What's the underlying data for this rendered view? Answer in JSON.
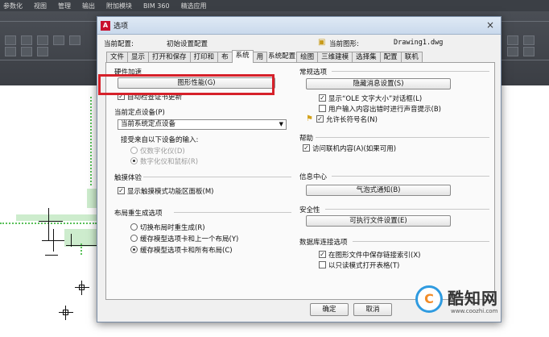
{
  "cad": {
    "menu": [
      "参数化",
      "视图",
      "管理",
      "输出",
      "附加模块",
      "BIM 360",
      "精选应用"
    ]
  },
  "dialog": {
    "title": "选项",
    "close": "×",
    "current_profile_label": "当前配置:",
    "current_profile_value": "初始设置配置",
    "current_drawing_label": "当前图形:",
    "current_drawing_value": "Drawing1.dwg",
    "tabs": [
      "文件",
      "显示",
      "打开和保存",
      "打印和",
      "布",
      "系统",
      "用",
      "绘图",
      "三维建模",
      "选择集",
      "配置",
      "联机"
    ],
    "tabs_extra": "系统配置",
    "left": {
      "hw_group": "硬件加速",
      "graphics_perf_button": "图形性能(G)",
      "auto_check_cert": "自动检查证书更新",
      "pointing_group": "当前定点设备(P)",
      "pointing_select": "当前系统定点设备",
      "accept_input_label": "接受来自以下设备的输入:",
      "digitizer_only": "仅数字化仪(D)",
      "digitizer_and_mouse": "数字化仪和鼠标(R)",
      "touch_group": "触摸体验",
      "show_touch_panel": "显示触摸模式功能区面板(M)",
      "layout_regen_group": "布局重生成选项",
      "regen_switch": "切换布局时重生成(R)",
      "regen_cache_prev": "缓存模型选项卡和上一个布局(Y)",
      "regen_cache_all": "缓存模型选项卡和所有布局(C)"
    },
    "right": {
      "general_group": "常规选项",
      "hidden_msg_button": "隐藏消息设置(S)",
      "show_ole_size": "显示“OLE 文字大小”对话框(L)",
      "beep_on_error": "用户输入内容出错时进行声音提示(B)",
      "allow_long_names": "允许长符号名(N)",
      "help_group": "帮助",
      "online_access": "访问联机内容(A)(如果可用)",
      "info_center_group": "信息中心",
      "balloon_button": "气泡式通知(B)",
      "security_group": "安全性",
      "exec_settings_button": "可执行文件设置(E)",
      "db_conn_group": "数据库连接选项",
      "store_links_index": "在图形文件中保存链接索引(X)",
      "open_tables_readonly": "以只读模式打开表格(T)"
    },
    "buttons": {
      "ok": "确定",
      "cancel": "取消"
    }
  },
  "watermark": {
    "logo_char": "C",
    "name": "酷知网",
    "url": "www.coozhi.com"
  }
}
